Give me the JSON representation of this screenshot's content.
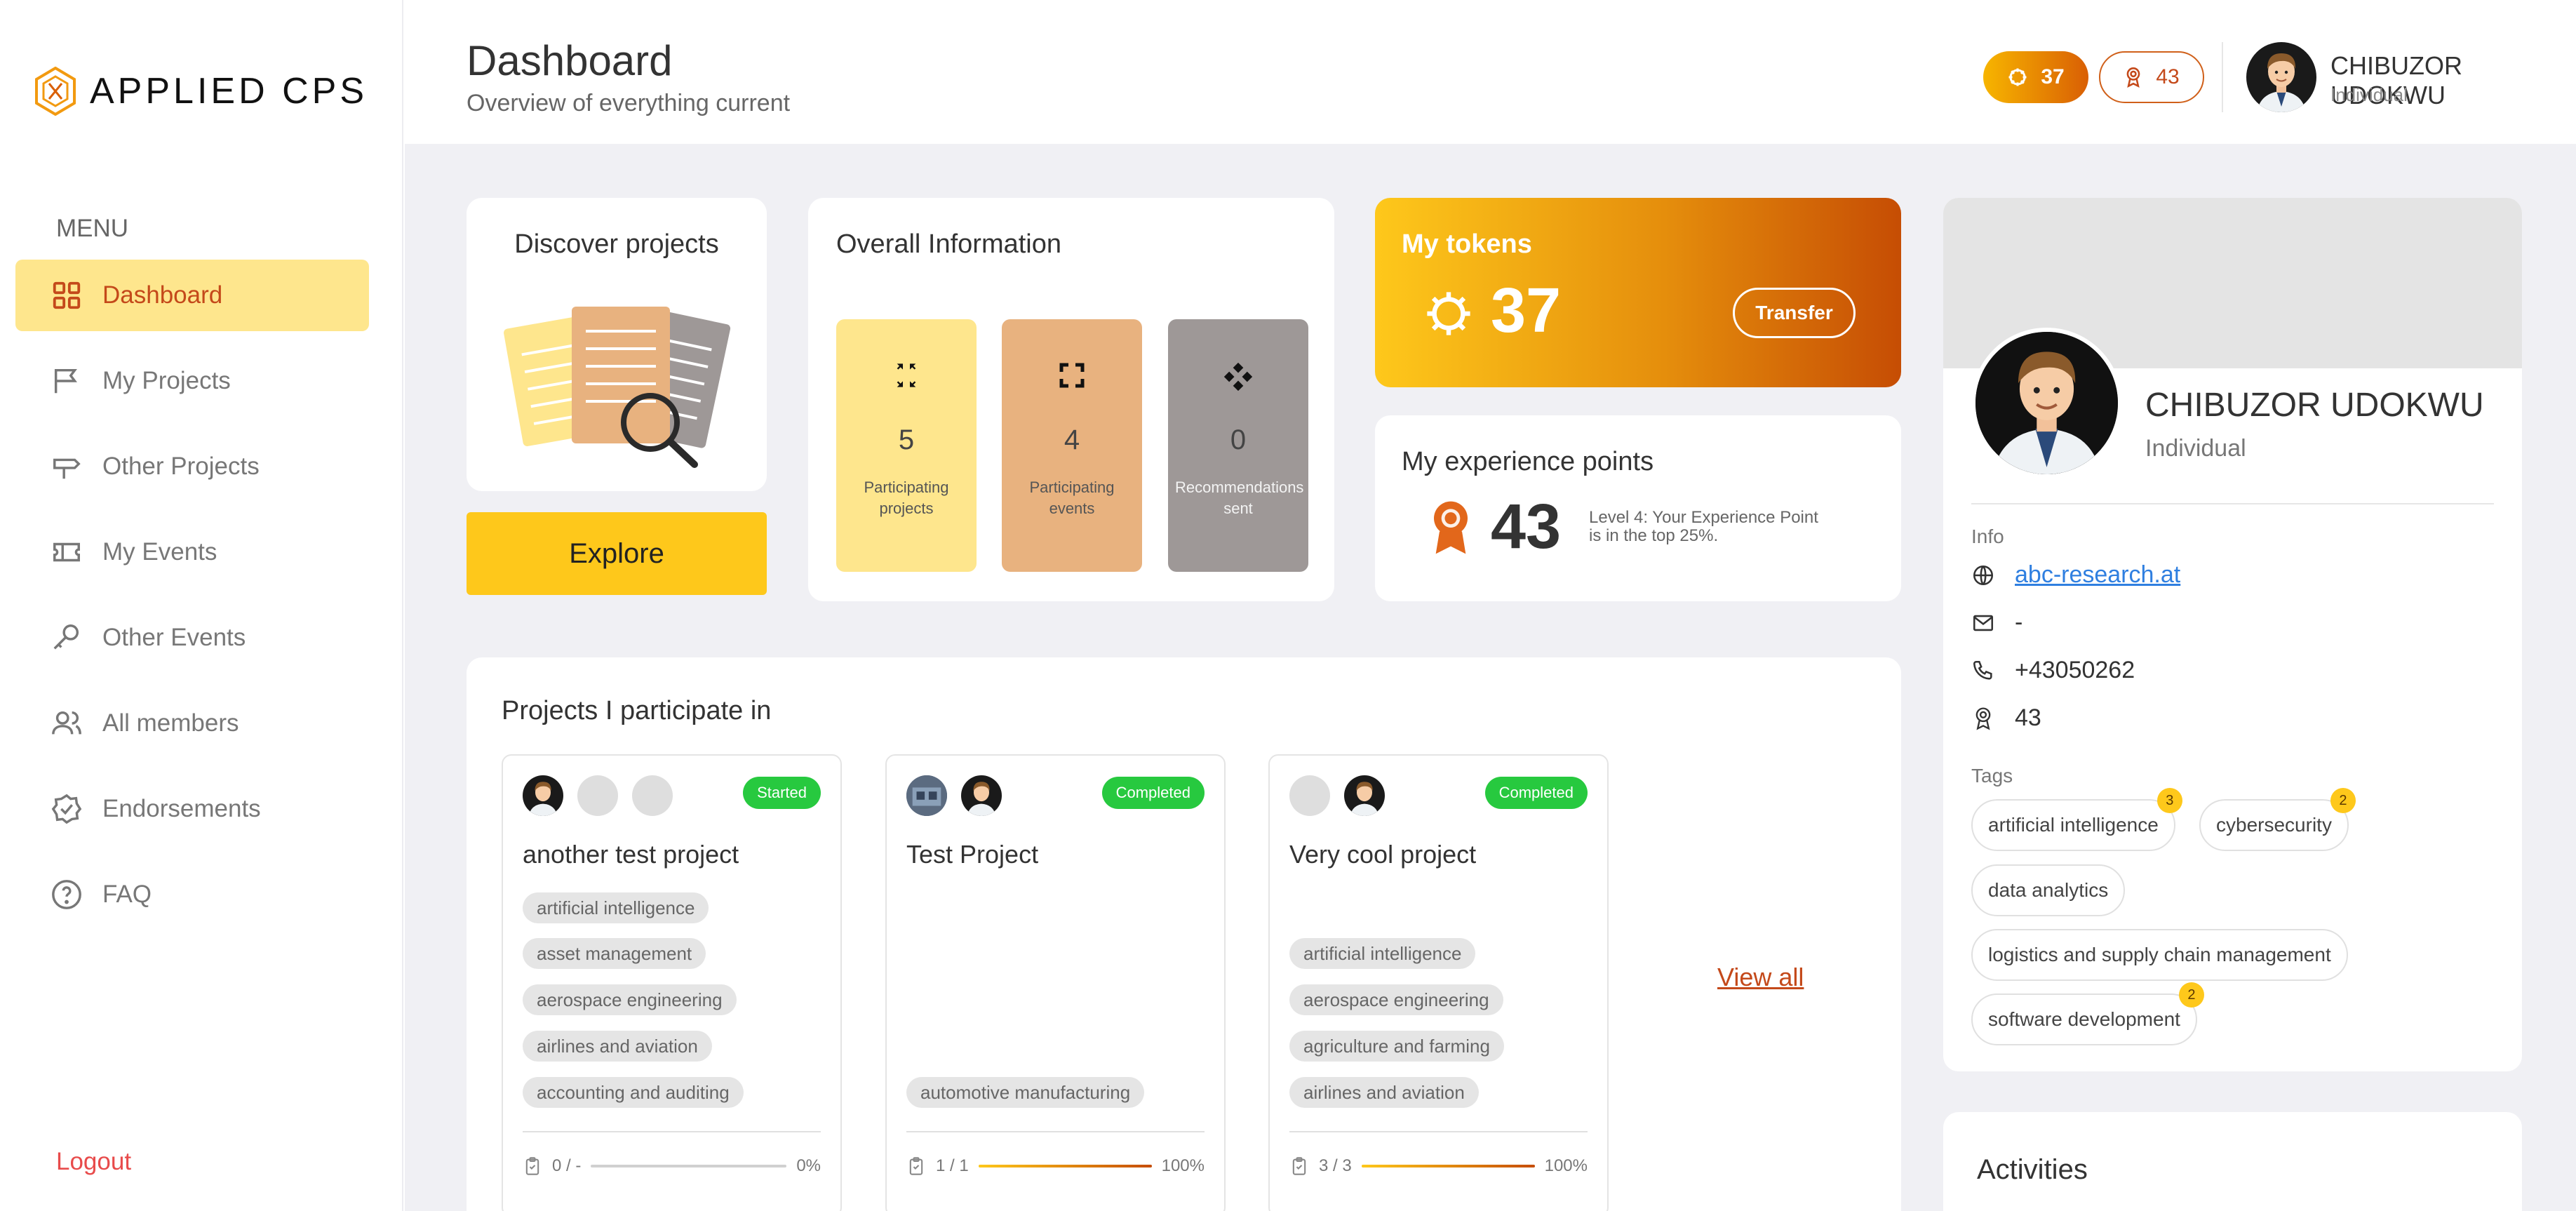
{
  "brand": {
    "name": "APPLIED CPS"
  },
  "sidebar": {
    "menu_title": "MENU",
    "items": [
      {
        "label": "Dashboard",
        "icon": "grid-icon",
        "active": true
      },
      {
        "label": "My Projects",
        "icon": "flag-icon"
      },
      {
        "label": "Other Projects",
        "icon": "signpost-icon"
      },
      {
        "label": "My Events",
        "icon": "ticket-icon"
      },
      {
        "label": "Other Events",
        "icon": "key-icon"
      },
      {
        "label": "All members",
        "icon": "users-icon"
      },
      {
        "label": "Endorsements",
        "icon": "badge-check-icon"
      },
      {
        "label": "FAQ",
        "icon": "help-circle-icon"
      }
    ],
    "logout": "Logout"
  },
  "header": {
    "title": "Dashboard",
    "subtitle": "Overview of everything current",
    "tokens": "37",
    "xp": "43",
    "user_name": "CHIBUZOR UDOKWU",
    "user_role": "Individual"
  },
  "discover": {
    "title": "Discover projects",
    "button": "Explore"
  },
  "overall": {
    "title": "Overall Information",
    "tiles": [
      {
        "value": "5",
        "label": "Participating projects",
        "color": "#fee68d"
      },
      {
        "value": "4",
        "label": "Participating events",
        "color": "#e8b27f"
      },
      {
        "value": "0",
        "label": "Recommendations sent",
        "color": "#9e9897"
      }
    ]
  },
  "tokens_card": {
    "title": "My tokens",
    "value": "37",
    "button": "Transfer"
  },
  "xp_card": {
    "title": "My experience points",
    "value": "43",
    "description": "Level 4: Your Experience Point is in the top 25%."
  },
  "projects": {
    "title": "Projects I participate in",
    "view_all": "View all",
    "items": [
      {
        "title": "another test project",
        "status": "Started",
        "tags": [
          "artificial intelligence",
          "asset management",
          "aerospace engineering",
          "airlines and aviation",
          "accounting and auditing"
        ],
        "progress_text": "0 / -",
        "progress_pct": "0%",
        "progress": 0
      },
      {
        "title": "Test Project",
        "status": "Completed",
        "tags": [
          "automotive manufacturing"
        ],
        "progress_text": "1 / 1",
        "progress_pct": "100%",
        "progress": 1
      },
      {
        "title": "Very cool project",
        "status": "Completed",
        "tags": [
          "artificial intelligence",
          "aerospace engineering",
          "agriculture and farming",
          "airlines and aviation"
        ],
        "progress_text": "3 / 3",
        "progress_pct": "100%",
        "progress": 1
      }
    ]
  },
  "profile": {
    "name": "CHIBUZOR UDOKWU",
    "role": "Individual",
    "info_label": "Info",
    "website": "abc-research.at",
    "email": "-",
    "phone": "+43050262",
    "xp": "43",
    "tags_label": "Tags",
    "tags": [
      {
        "label": "artificial intelligence",
        "count": "3"
      },
      {
        "label": "cybersecurity",
        "count": "2"
      },
      {
        "label": "data analytics",
        "count": ""
      },
      {
        "label": "logistics and supply chain management",
        "count": ""
      },
      {
        "label": "software development",
        "count": "2"
      }
    ]
  },
  "activities": {
    "title": "Activities"
  },
  "colors": {
    "accent": "#fec81b",
    "accent_dark": "#c4491a",
    "success": "#27c93f"
  }
}
